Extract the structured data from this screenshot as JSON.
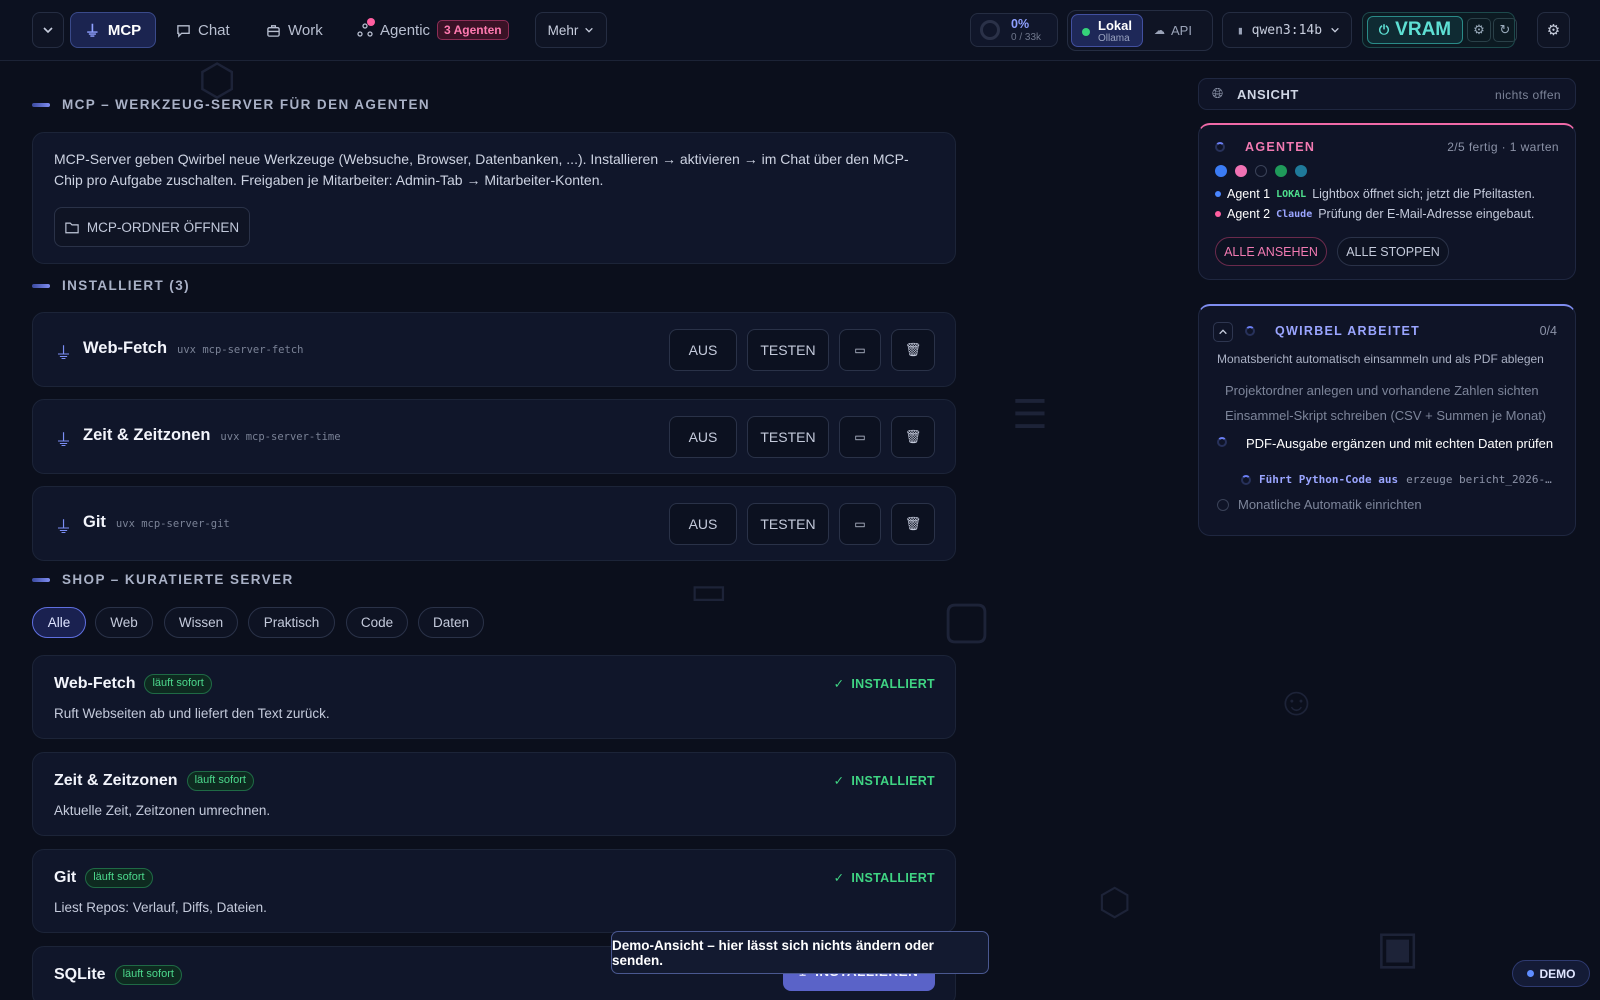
{
  "nav": {
    "tabs": [
      {
        "label": "MCP",
        "icon": "plug-icon"
      },
      {
        "label": "Chat",
        "icon": "chat-icon"
      },
      {
        "label": "Work",
        "icon": "briefcase-icon"
      },
      {
        "label": "Agentic",
        "icon": "network-icon"
      }
    ],
    "agents_badge": "3 Agenten",
    "more_label": "Mehr",
    "context": {
      "percent": "0%",
      "tokens": "0 / 33k"
    },
    "mode": {
      "local_label": "Lokal",
      "local_sub": "Ollama",
      "api_label": "API"
    },
    "model": "qwen3:14b",
    "vram_label": "VRAM"
  },
  "main": {
    "mcp_title": "MCP – WERKZEUG-SERVER FÜR DEN AGENTEN",
    "info_text": "MCP-Server geben Qwirbel neue Werkzeuge (Websuche, Browser, Datenbanken, ...). Installieren → aktivieren → im Chat über den MCP-Chip pro Aufgabe zuschalten. Freigaben je Mitarbeiter: Admin-Tab → Mitarbeiter-Konten.",
    "open_folder": "MCP-ORDNER ÖFFNEN",
    "installed_title": "INSTALLIERT (3)",
    "installed": [
      {
        "name": "Web-Fetch",
        "cmd": "uvx mcp-server-fetch"
      },
      {
        "name": "Zeit & Zeitzonen",
        "cmd": "uvx mcp-server-time"
      },
      {
        "name": "Git",
        "cmd": "uvx mcp-server-git"
      }
    ],
    "off_label": "AUS",
    "test_label": "TESTEN",
    "shop_title": "SHOP – KURATIERTE SERVER",
    "filters": [
      "Alle",
      "Web",
      "Wissen",
      "Praktisch",
      "Code",
      "Daten"
    ],
    "runs_label": "läuft sofort",
    "installed_label": "INSTALLIERT",
    "install_label": "INSTALLIEREN",
    "shop": [
      {
        "name": "Web-Fetch",
        "desc": "Ruft Webseiten ab und liefert den Text zurück."
      },
      {
        "name": "Zeit & Zeitzonen",
        "desc": "Aktuelle Zeit, Zeitzonen umrechnen."
      },
      {
        "name": "Git",
        "desc": "Liest Repos: Verlauf, Diffs, Dateien."
      },
      {
        "name": "SQLite",
        "desc": ""
      }
    ]
  },
  "side": {
    "view_title": "ANSICHT",
    "view_status": "nichts offen",
    "agents": {
      "title": "AGENTEN",
      "status": "2/5 fertig · 1 warten",
      "lights": [
        "#3b7cf5",
        "#f072b4",
        "#0f1427",
        "#1f9a5a",
        "#1f7a9a"
      ],
      "rows": [
        {
          "name": "Agent 1",
          "tag": "LOKAL",
          "text": "Lightbox öffnet sich; jetzt die Pfeiltasten.",
          "dot": "#4a86ff",
          "tag_color": "#4ee08d"
        },
        {
          "name": "Agent 2",
          "tag": "Claude",
          "text": "Prüfung der E-Mail-Adresse eingebaut.",
          "dot": "#ff5fa0",
          "tag_color": "#9aa5ff"
        }
      ],
      "view_all": "ALLE ANSEHEN",
      "stop_all": "ALLE STOPPEN"
    },
    "work": {
      "title": "QWIRBEL ARBEITET",
      "count": "0/4",
      "task": "Monatsbericht automatisch einsammeln und als PDF ablegen",
      "steps": [
        "Projektordner anlegen und vorhandene Zahlen sichten",
        "Einsammel-Skript schreiben (CSV + Summen je Monat)",
        "PDF-Ausgabe ergänzen und mit echten Daten prüfen",
        "Monatliche Automatik einrichten"
      ],
      "sub_label": "Führt Python-Code aus",
      "sub_arg": "erzeuge bericht_2026-…"
    }
  },
  "toast": "Demo-Ansicht – hier lässt sich nichts ändern oder senden.",
  "demo_label": "DEMO"
}
